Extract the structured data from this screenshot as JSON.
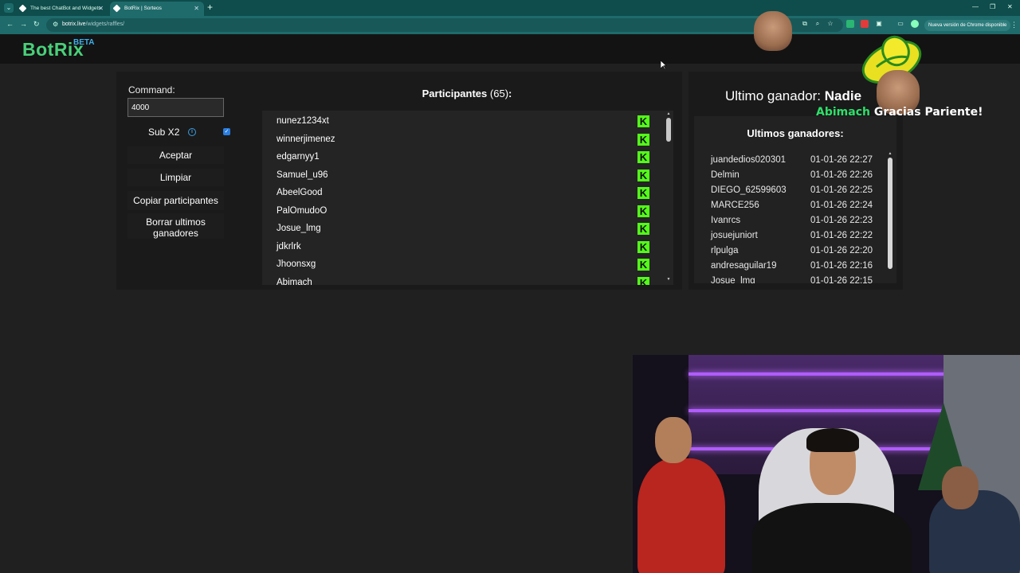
{
  "browser": {
    "tabs": [
      {
        "title": "The best ChatBot and Widgets"
      },
      {
        "title": "BotRix | Sorteos"
      }
    ],
    "url_host": "botrix.live",
    "url_path": "/widgets/raffles/",
    "update_label": "Nueva versión de Chrome disponible"
  },
  "brand": {
    "name": "BotRix",
    "badge": "BETA"
  },
  "controls": {
    "command_label": "Command:",
    "command_value": "4000",
    "sub_label": "Sub X2",
    "sub_checked": true,
    "buttons": {
      "accept": "Aceptar",
      "clear": "Limpiar",
      "copy": "Copiar participantes",
      "delete_line1": "Borrar ultimos",
      "delete_line2": "ganadores"
    }
  },
  "participants": {
    "title": "Participantes",
    "count_text": "(65)",
    "suffix": ":",
    "list": [
      "nunez1234xt",
      "winnerjimenez",
      "edgarnyy1",
      "Samuel_u96",
      "AbeelGood",
      "PalOmudoO",
      "Josue_lmg",
      "jdkrlrk",
      "Jhoonsxg",
      "Abimach"
    ]
  },
  "winner": {
    "prefix": "Ultimo ganador:",
    "name": "Nadie"
  },
  "recent_winners": {
    "title": "Ultimos ganadores:",
    "rows": [
      {
        "name": "juandedios020301",
        "time": "01-01-26 22:27"
      },
      {
        "name": "Delmin",
        "time": "01-01-26 22:26"
      },
      {
        "name": "DIEGO_62599603",
        "time": "01-01-26 22:25"
      },
      {
        "name": "MARCE256",
        "time": "01-01-26 22:24"
      },
      {
        "name": "Ivanrcs",
        "time": "01-01-26 22:23"
      },
      {
        "name": "josuejuniort",
        "time": "01-01-26 22:22"
      },
      {
        "name": "rlpulga",
        "time": "01-01-26 22:20"
      },
      {
        "name": "andresaguilar19",
        "time": "01-01-26 22:16"
      },
      {
        "name": "Josue_lmg",
        "time": "01-01-26 22:15"
      }
    ]
  },
  "stream_alert": {
    "name": "Abimach",
    "message": "Gracias Pariente!"
  },
  "colors": {
    "brand_green": "#4ad07a",
    "kick_green": "#53fc18",
    "beta_blue": "#3db0e8"
  }
}
